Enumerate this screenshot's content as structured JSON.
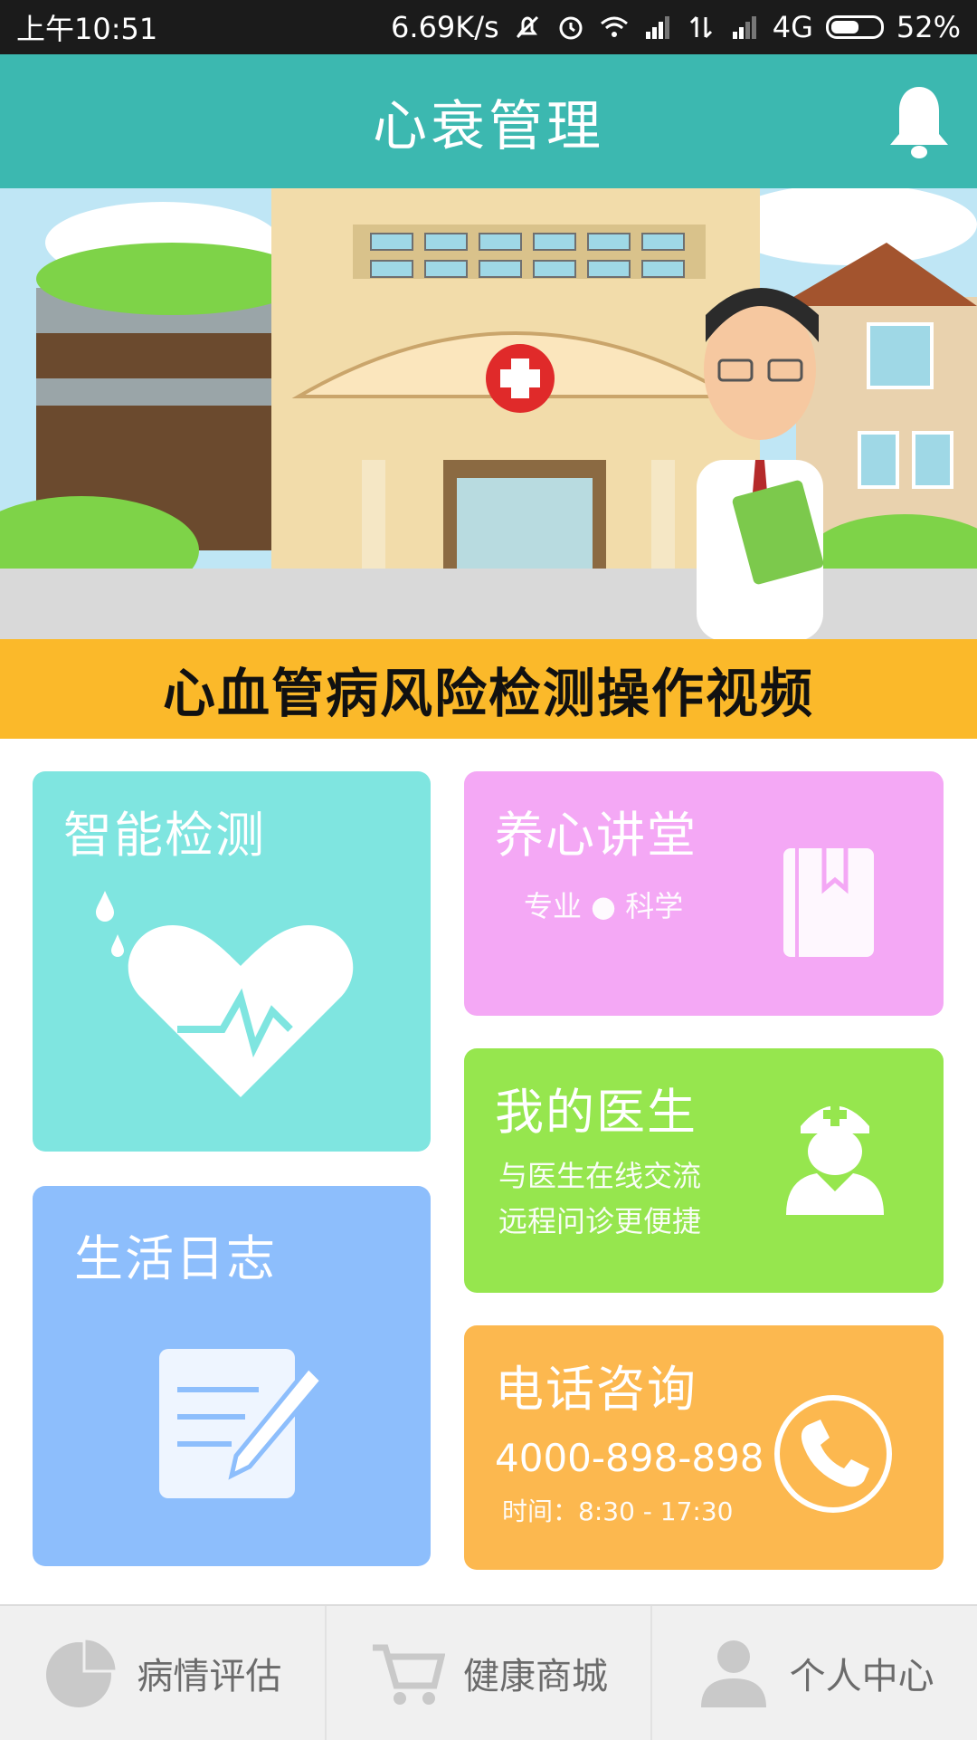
{
  "status_bar": {
    "time": "上午10:51",
    "speed": "6.69K/s",
    "network": "4G",
    "battery": "52%",
    "battery_level": 0.52
  },
  "header": {
    "title": "心衰管理",
    "bell_icon": "bell-icon"
  },
  "banner": {
    "caption": "心血管病风险检测操作视频",
    "slide_count": 2,
    "active_slide": 2
  },
  "cards": {
    "detect": {
      "title": "智能检测",
      "icon": "heart-icon"
    },
    "class": {
      "title": "养心讲堂",
      "subtitle": "专业 ● 科学",
      "icon": "book-icon"
    },
    "doctor": {
      "title": "我的医生",
      "line1": "与医生在线交流",
      "line2": "远程问诊更便捷",
      "icon": "doctor-icon"
    },
    "log": {
      "title": "生活日志",
      "icon": "note-edit-icon"
    },
    "phone": {
      "title": "电话咨询",
      "number": "4000-898-898",
      "hours": "时间：8:30 - 17:30",
      "icon": "phone-icon"
    }
  },
  "bottom_nav": [
    {
      "label": "病情评估",
      "icon": "pie-chart-icon"
    },
    {
      "label": "健康商城",
      "icon": "cart-icon"
    },
    {
      "label": "个人中心",
      "icon": "person-icon"
    }
  ],
  "colors": {
    "header": "#3cb8b0",
    "caption_bg": "#fbb92a",
    "detect": "#7fe5e0",
    "class": "#f4a8f5",
    "doctor": "#96e64e",
    "log": "#8dbefc",
    "phone": "#fcb84f"
  }
}
